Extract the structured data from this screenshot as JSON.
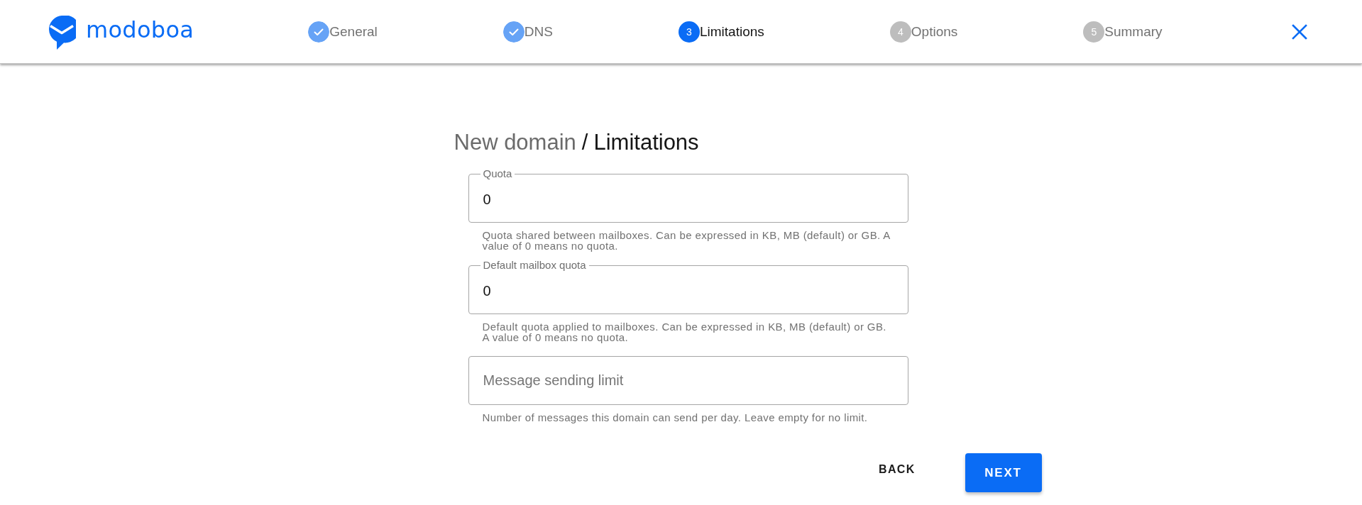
{
  "header": {
    "logo": {
      "text": "modoboa"
    },
    "steps": [
      {
        "label": "General",
        "completed": true,
        "selected": false
      },
      {
        "label": "DNS",
        "completed": true,
        "selected": false
      },
      {
        "number": "3",
        "label": "Limitations",
        "completed": false,
        "selected": true
      },
      {
        "number": "4",
        "label": "Options",
        "completed": false,
        "selected": false
      },
      {
        "number": "5",
        "label": "Summary",
        "completed": false,
        "selected": false
      }
    ]
  },
  "breadcrumb": {
    "items": [
      {
        "label": "New domain",
        "current": false
      },
      {
        "label": "Limitations",
        "current": true
      }
    ],
    "separator": "/"
  },
  "fields": [
    {
      "label": "Quota",
      "value": "0",
      "hint": "Quota shared between mailboxes. Can be expressed in KB, MB (default) or GB. A value of 0 means no quota."
    },
    {
      "label": "Default mailbox quota",
      "value": "0",
      "hint": "Default quota applied to mailboxes. Can be expressed in KB, MB (default) or GB. A value of 0 means no quota."
    },
    {
      "placeholder": "Message sending limit",
      "hint": "Number of messages this domain can send per day. Leave empty for no limit."
    }
  ],
  "buttons": [
    {
      "label": "BACK",
      "kind": "text"
    },
    {
      "label": "NEXT",
      "kind": "primary"
    }
  ]
}
